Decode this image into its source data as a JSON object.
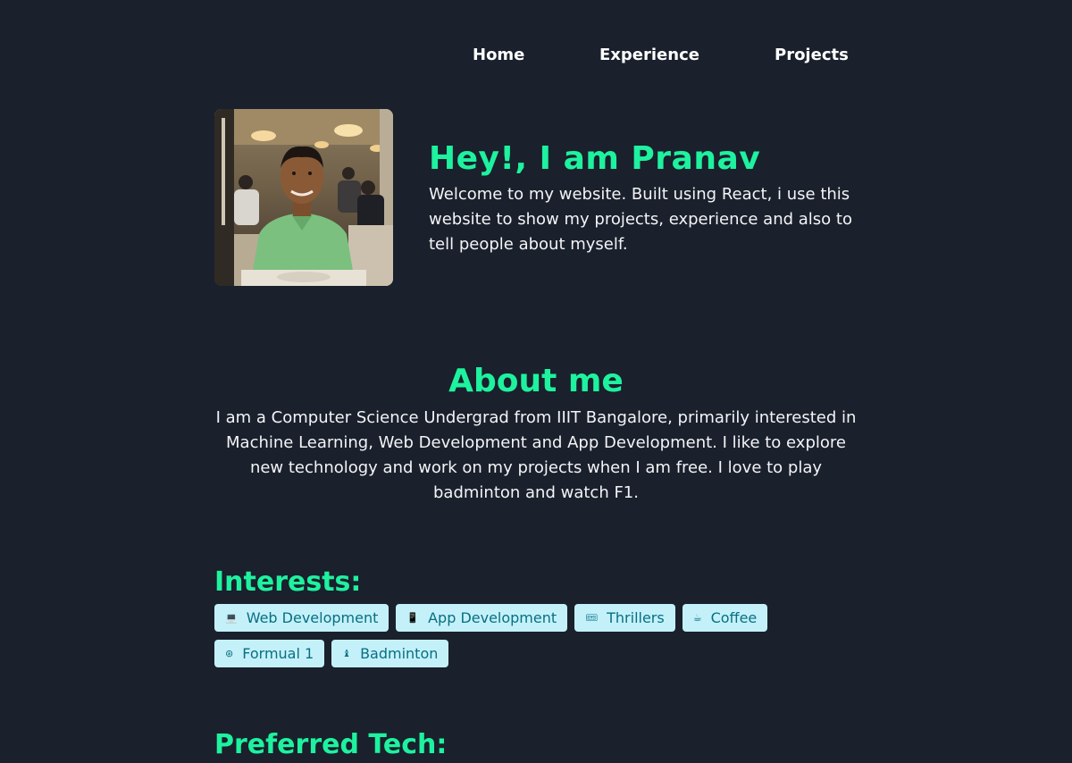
{
  "nav": {
    "items": [
      {
        "label": "Home"
      },
      {
        "label": "Experience"
      },
      {
        "label": "Projects"
      }
    ]
  },
  "hero": {
    "title": "Hey!, I am Pranav",
    "description": "Welcome to my website. Built using React, i use this website to show my projects, experience and also to tell people about myself."
  },
  "about": {
    "title": "About me",
    "body": "I am a Computer Science Undergrad from IIIT Bangalore, primarily interested in Machine Learning, Web Development and App Development. I like to explore new technology and work on my projects when I am free. I love to play badminton and watch F1."
  },
  "interests": {
    "title": "Interests:",
    "items": [
      {
        "icon": "laptop-icon",
        "glyph": "💻",
        "label": "Web Development"
      },
      {
        "icon": "phone-icon",
        "glyph": "📱",
        "label": "App Development"
      },
      {
        "icon": "ticket-icon",
        "glyph": "🎟",
        "label": "Thrillers"
      },
      {
        "icon": "coffee-icon",
        "glyph": "☕",
        "label": "Coffee"
      },
      {
        "icon": "steering-wheel-icon",
        "glyph": "⊛",
        "label": "Formual 1"
      },
      {
        "icon": "badminton-icon",
        "glyph": "♝",
        "label": "Badminton"
      }
    ]
  },
  "tech": {
    "title": "Preferred Tech:"
  },
  "colors": {
    "background": "#1a202c",
    "accent": "#1ef29f",
    "chip_bg": "#c4f1f9",
    "chip_text": "#086f83"
  }
}
